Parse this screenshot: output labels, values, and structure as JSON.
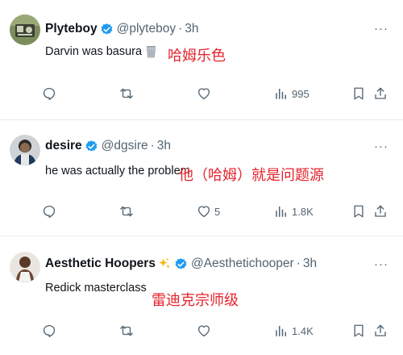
{
  "tweets": [
    {
      "name": "Plyteboy",
      "handle": "@plyteboy",
      "separator": "·",
      "time": "3h",
      "text": "Darvin was basura",
      "annotation": "哈姆乐色",
      "replies": "",
      "retweets": "",
      "likes": "",
      "views": "995"
    },
    {
      "name": "desire",
      "handle": "@dgsire",
      "separator": "·",
      "time": "3h",
      "text": "he was actually the problem",
      "annotation": "他（哈姆）就是问题源",
      "replies": "",
      "retweets": "",
      "likes": "5",
      "views": "1.8K"
    },
    {
      "name": "Aesthetic Hoopers",
      "handle": "@Aesthetichooper",
      "separator": "·",
      "time": "3h",
      "text": "Redick masterclass",
      "annotation": "雷迪克宗师级",
      "replies": "",
      "retweets": "",
      "likes": "",
      "views": "1.4K"
    }
  ],
  "more_label": "···",
  "colors": {
    "verified": "#1d9bf0",
    "annotation": "#e5232d",
    "muted": "#536471",
    "text": "#0f1419"
  },
  "icons": {
    "reply": "reply-icon",
    "retweet": "retweet-icon",
    "like": "heart-icon",
    "views": "views-icon",
    "bookmark": "bookmark-icon",
    "share": "share-icon",
    "verified": "verified-badge-icon",
    "more": "more-icon",
    "trash": "wastebasket-emoji-icon",
    "sparkle": "sparkles-emoji-icon"
  }
}
